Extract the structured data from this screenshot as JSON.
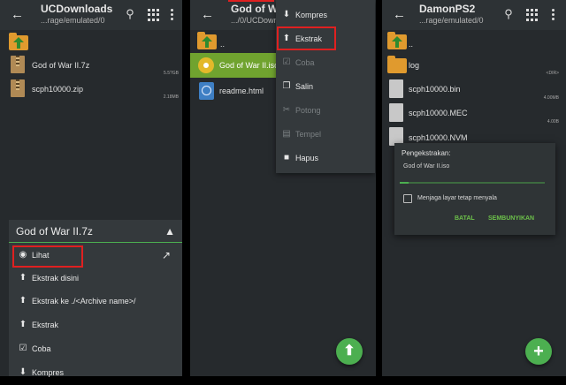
{
  "panel1": {
    "title": "UCDownloads",
    "subtitle": "...rage/emulated/0",
    "files": [
      {
        "name": "God of War II.7z",
        "size": "5.5?GB"
      },
      {
        "name": "scph10000.zip",
        "size": "2.18MB"
      }
    ],
    "sheet": {
      "title": "God of War II.7z",
      "items": [
        {
          "label": "Lihat",
          "icon": "eye-icon"
        },
        {
          "label": "Ekstrak disini",
          "icon": "extract-icon"
        },
        {
          "label": "Ekstrak ke ./<Archive name>/",
          "icon": "extract-icon"
        },
        {
          "label": "Ekstrak",
          "icon": "extract-icon"
        },
        {
          "label": "Coba",
          "icon": "check-icon"
        },
        {
          "label": "Kompres",
          "icon": "compress-icon"
        }
      ]
    }
  },
  "panel2": {
    "title": "God of Wa",
    "subtitle": ".../0/UCDown",
    "up_label": "..",
    "files": [
      {
        "name": "God of War II.iso",
        "selected": true
      },
      {
        "name": "readme.html",
        "selected": false
      }
    ],
    "menu": [
      {
        "label": "Kompres",
        "icon": "compress-icon",
        "enabled": true
      },
      {
        "label": "Ekstrak",
        "icon": "extract-icon",
        "enabled": true,
        "highlighted": true
      },
      {
        "label": "Coba",
        "icon": "check-icon",
        "enabled": false
      },
      {
        "label": "Salin",
        "icon": "copy-icon",
        "enabled": true
      },
      {
        "label": "Potong",
        "icon": "cut-icon",
        "enabled": false
      },
      {
        "label": "Tempel",
        "icon": "paste-icon",
        "enabled": false
      },
      {
        "label": "Hapus",
        "icon": "delete-icon",
        "enabled": true
      }
    ]
  },
  "panel3": {
    "title": "DamonPS2",
    "subtitle": "...rage/emulated/0",
    "up_label": "..",
    "files": [
      {
        "name": "log",
        "size": "<DIR>",
        "type": "folder"
      },
      {
        "name": "scph10000.bin",
        "size": "4.00MB",
        "type": "file"
      },
      {
        "name": "scph10000.MEC",
        "size": "4.00B",
        "type": "file"
      },
      {
        "name": "scph10000.NVM",
        "size": "",
        "type": "file"
      }
    ],
    "dialog": {
      "title": "Pengekstrakan:",
      "file": "God of War II.iso",
      "progress": 0.06,
      "checkbox_label": "Menjaga layar tetap menyala",
      "cancel": "BATAL",
      "hide": "SEMBUNYIKAN"
    }
  },
  "colors": {
    "accent": "#4caf50",
    "highlight": "#e02020",
    "selected_row": "#70a32f",
    "folder": "#e09a2e"
  }
}
